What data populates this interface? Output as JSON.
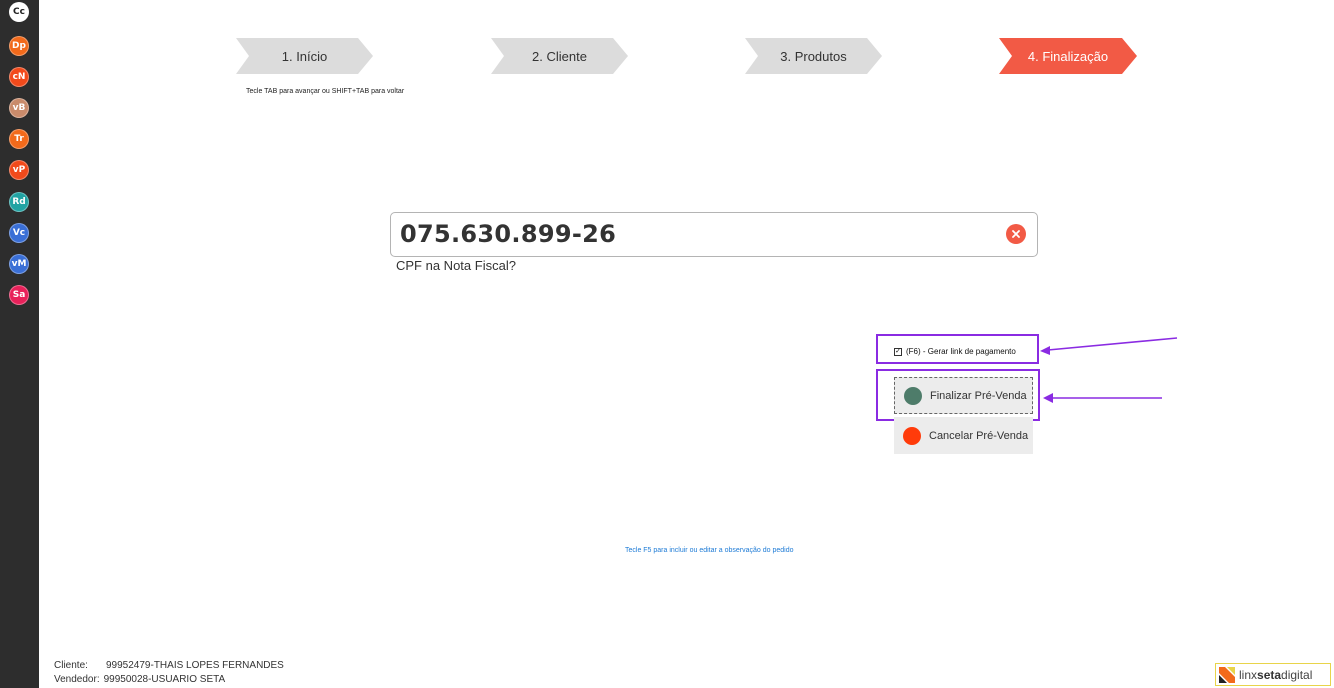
{
  "sidebar": {
    "items": [
      {
        "label": "Cc",
        "color": "#ffffff",
        "text_color": "#222222"
      },
      {
        "label": "Dp",
        "color": "#f26a1b"
      },
      {
        "label": "cN",
        "color": "#f24a1b"
      },
      {
        "label": "vB",
        "color": "#c98b6b"
      },
      {
        "label": "Tr",
        "color": "#f26a1b"
      },
      {
        "label": "vP",
        "color": "#f24a1b"
      },
      {
        "label": "Rd",
        "color": "#21a3a3"
      },
      {
        "label": "Vc",
        "color": "#3a6fd6"
      },
      {
        "label": "vM",
        "color": "#3a6fd6"
      },
      {
        "label": "Sa",
        "color": "#e8215a"
      }
    ]
  },
  "steps": [
    {
      "label": "1. Início",
      "active": false
    },
    {
      "label": "2. Cliente",
      "active": false
    },
    {
      "label": "3. Produtos",
      "active": false
    },
    {
      "label": "4. Finalização",
      "active": true
    }
  ],
  "colors": {
    "step_inactive": "#dcdcdc",
    "step_active": "#f25a45",
    "highlight": "#8a2be2",
    "finalize_dot": "#4e7c6a",
    "cancel_dot": "#ff3b0a",
    "link": "#1e7bd6"
  },
  "hint_tab": "Tecle TAB para avançar ou SHIFT+TAB para voltar",
  "cpf": {
    "value": "075.630.899-26",
    "label": "CPF na Nota Fiscal?",
    "clear_icon": "close-circle-icon"
  },
  "payment_link": {
    "checked": true,
    "label": "(F6) - Gerar link de pagamento"
  },
  "buttons": {
    "finalize": "Finalizar Pré-Venda",
    "cancel": "Cancelar Pré-Venda"
  },
  "hint_f5": "Tecle F5 para incluir ou editar a observação do pedido",
  "footer": {
    "client_label": "Cliente:",
    "client_value": "99952479-THAIS LOPES FERNANDES",
    "seller_label": "Vendedor:",
    "seller_value": "99950028-USUARIO SETA"
  },
  "logo": {
    "text_light": "linx ",
    "text_bold": "seta",
    "text_tail": "digital"
  }
}
